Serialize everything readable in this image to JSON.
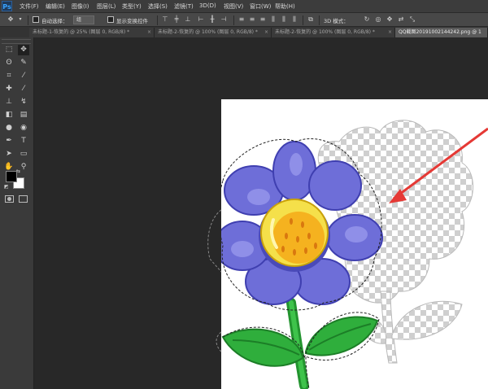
{
  "app": {
    "logo": "Ps"
  },
  "menu": [
    "文件(F)",
    "编辑(E)",
    "图像(I)",
    "图层(L)",
    "类型(Y)",
    "选择(S)",
    "滤镜(T)",
    "3D(D)",
    "视图(V)",
    "窗口(W)",
    "帮助(H)"
  ],
  "options_bar": {
    "auto_select_label": "自动选择：",
    "auto_select_value": "组",
    "show_transform_label": "显示变换控件",
    "mode_3d_label": "3D 模式："
  },
  "tabs": [
    {
      "label": "未标题-1-恢复的 @ 25% (图层 0, RGB/8) *",
      "active": false
    },
    {
      "label": "未标题-2-恢复的 @ 100% (图层 0, RGB/8) *",
      "active": false
    },
    {
      "label": "未标题-2-恢复的 @ 100% (图层 0, RGB/8) *",
      "active": false
    },
    {
      "label": "QQ截图20191002144242.png @ 1",
      "active": true
    }
  ],
  "tab_close": "×",
  "tools": [
    {
      "icon": "marquee-icon",
      "glyph": "⬚"
    },
    {
      "icon": "move-icon",
      "glyph": "✥"
    },
    {
      "icon": "lasso-icon",
      "glyph": "ʘ"
    },
    {
      "icon": "quick-select-icon",
      "glyph": "✎"
    },
    {
      "icon": "crop-icon",
      "glyph": "⌗"
    },
    {
      "icon": "eyedropper-icon",
      "glyph": "⁄"
    },
    {
      "icon": "healing-icon",
      "glyph": "✚"
    },
    {
      "icon": "brush-icon",
      "glyph": "⁄"
    },
    {
      "icon": "stamp-icon",
      "glyph": "⊥"
    },
    {
      "icon": "history-brush-icon",
      "glyph": "↯"
    },
    {
      "icon": "eraser-icon",
      "glyph": "◧"
    },
    {
      "icon": "gradient-icon",
      "glyph": "▤"
    },
    {
      "icon": "blur-icon",
      "glyph": "●"
    },
    {
      "icon": "dodge-icon",
      "glyph": "◉"
    },
    {
      "icon": "pen-icon",
      "glyph": "✒"
    },
    {
      "icon": "type-icon",
      "glyph": "T"
    },
    {
      "icon": "path-select-icon",
      "glyph": "➤"
    },
    {
      "icon": "shape-icon",
      "glyph": "▭"
    },
    {
      "icon": "hand-icon",
      "glyph": "✋"
    },
    {
      "icon": "zoom-icon",
      "glyph": "⚲"
    }
  ],
  "colors": {
    "menubar": "#3c3c3c",
    "panel": "#3a3a3a",
    "workspace": "#282828",
    "foreground_color": "#000000",
    "background_color": "#ffffff",
    "petal": "#6e6ed8",
    "petal_dark": "#4a4ab8",
    "center": "#f5c518",
    "leaf": "#2fae3c",
    "arrow": "#e53935"
  }
}
